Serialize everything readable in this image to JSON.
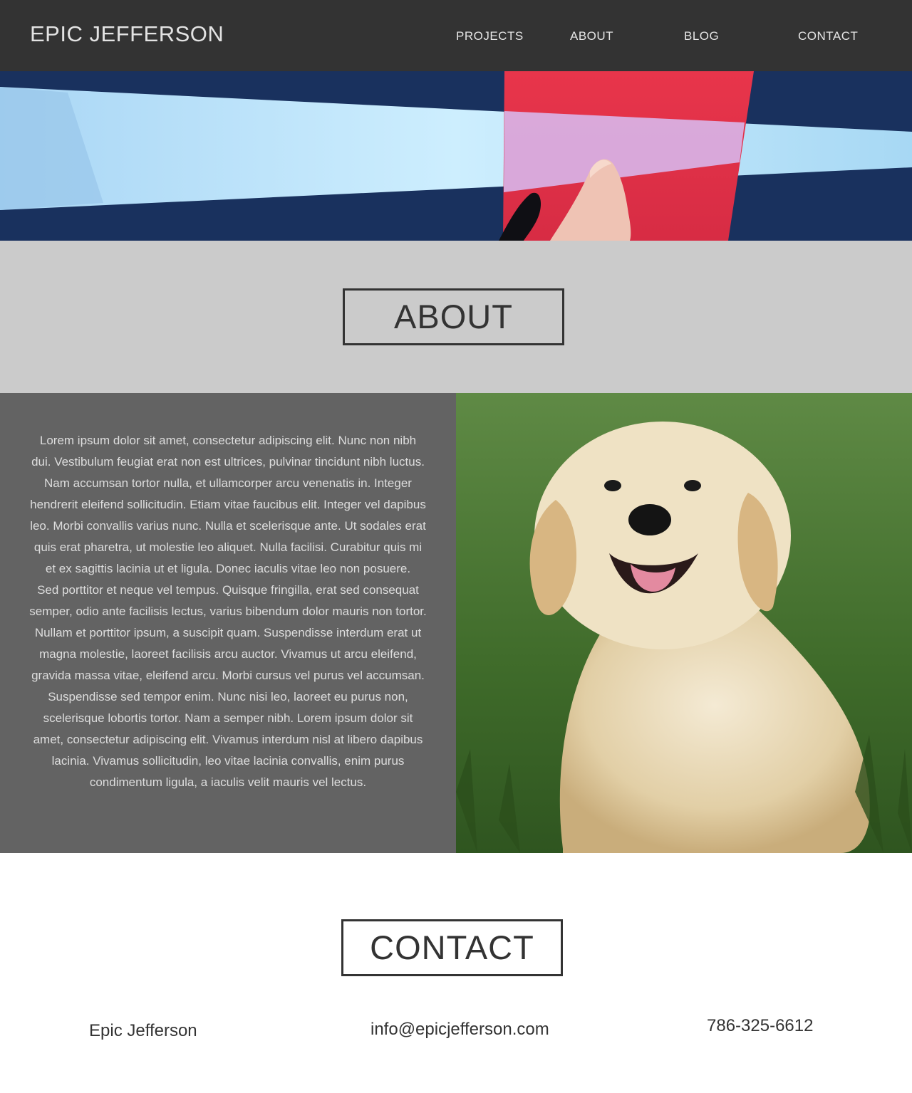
{
  "header": {
    "brand": "EPIC JEFFERSON",
    "nav": [
      "PROJECTS",
      "ABOUT",
      "BLOG",
      "CONTACT"
    ]
  },
  "about": {
    "title": "ABOUT",
    "paragraphs": [
      "Lorem ipsum dolor sit amet, consectetur adipiscing elit. Nunc non nibh dui. Vestibulum feugiat erat non est ultrices, pulvinar tincidunt nibh luctus. Nam accumsan tortor nulla, et ullamcorper arcu venenatis in. Integer hendrerit eleifend sollicitudin. Etiam vitae faucibus elit. Integer vel dapibus leo. Morbi convallis varius nunc. Nulla et scelerisque ante. Ut sodales erat quis erat pharetra, ut molestie leo aliquet. Nulla facilisi. Curabitur quis mi et ex sagittis lacinia ut et ligula. Donec iaculis vitae leo non posuere.",
      "Sed porttitor et neque vel tempus. Quisque fringilla, erat sed consequat semper, odio ante facilisis lectus, varius bibendum dolor mauris non tortor. Nullam et porttitor ipsum, a suscipit quam. Suspendisse interdum erat ut magna molestie, laoreet facilisis arcu auctor. Vivamus ut arcu eleifend, gravida massa vitae, eleifend arcu. Morbi cursus vel purus vel accumsan. Suspendisse sed tempor enim. Nunc nisi leo, laoreet eu purus non, scelerisque lobortis tortor. Nam a semper nibh. Lorem ipsum dolor sit amet, consectetur adipiscing elit. Vivamus interdum nisl at libero dapibus lacinia. Vivamus sollicitudin, leo vitae lacinia convallis, enim purus condimentum ligula, a iaculis velit mauris vel lectus."
    ]
  },
  "contact": {
    "title": "CONTACT",
    "name": "Epic Jefferson",
    "email": "info@epicjefferson.com",
    "phone": "786-325-6612"
  },
  "colors": {
    "header_bg": "#333333",
    "about_head_bg": "#cbcbcb",
    "about_text_bg": "#636363",
    "hero_navy": "#19315e",
    "hero_red": "#e5344a",
    "hero_light_blue": "#bfe6fb"
  }
}
